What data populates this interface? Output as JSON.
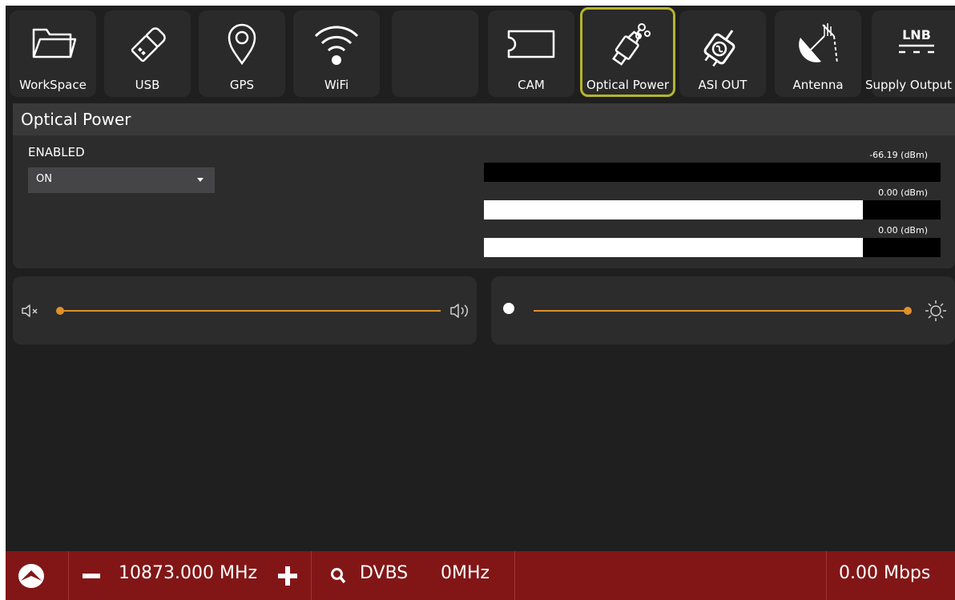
{
  "toolbar": {
    "items": [
      {
        "label": "WorkSpace",
        "icon": "folder-icon"
      },
      {
        "label": "USB",
        "icon": "usb-icon"
      },
      {
        "label": "GPS",
        "icon": "gps-pin-icon"
      },
      {
        "label": "WiFi",
        "icon": "wifi-icon"
      },
      {
        "label": "",
        "icon": ""
      },
      {
        "label": "CAM",
        "icon": "cam-card-icon"
      },
      {
        "label": "Optical Power",
        "icon": "optical-connector-icon"
      },
      {
        "label": "ASI OUT",
        "icon": "asi-connector-icon"
      },
      {
        "label": "Antenna",
        "icon": "antenna-icon"
      },
      {
        "label": "Supply Output",
        "icon": "lnb-icon",
        "icon_text": "LNB"
      }
    ]
  },
  "optical": {
    "title": "Optical Power",
    "enabled_label": "ENABLED",
    "enabled_value": "ON",
    "meters": [
      {
        "value": "-66.19 (dBm)",
        "fill": 0.0
      },
      {
        "value": "0.00 (dBm)",
        "fill": 0.83
      },
      {
        "value": "0.00 (dBm)",
        "fill": 0.83
      }
    ]
  },
  "volume": {
    "level": 0.0
  },
  "brightness": {
    "level": 1.0
  },
  "status": {
    "frequency": "10873.000 MHz",
    "standard": "DVBS",
    "bandwidth": "0MHz",
    "bitrate": "0.00 Mbps"
  },
  "colors": {
    "accent": "#e0902c",
    "status_bar": "#821616",
    "selected_outline": "#b5b52c"
  }
}
